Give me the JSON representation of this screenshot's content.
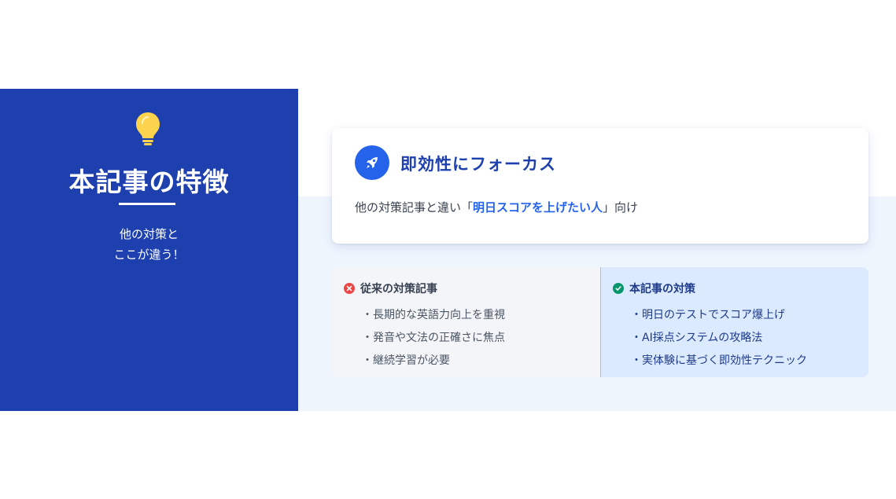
{
  "sidebar": {
    "icon": "lightbulb-icon",
    "title": "本記事の特徴",
    "subtitle_line1": "他の対策と",
    "subtitle_line2": "ここが違う！"
  },
  "card": {
    "icon": "rocket-icon",
    "heading": "即効性にフォーカス",
    "desc_before": "他の対策記事と違い「",
    "desc_highlight": "明日スコアを上げたい人",
    "desc_after": "」向け"
  },
  "comparison": {
    "old": {
      "icon": "x-circle-icon",
      "heading": "従来の対策記事",
      "items": [
        "長期的な英語力向上を重視",
        "発音や文法の正確さに焦点",
        "継続学習が必要"
      ]
    },
    "new": {
      "icon": "check-circle-icon",
      "heading": "本記事の対策",
      "items": [
        "明日のテストでスコア爆上げ",
        "AI採点システムの攻略法",
        "実体験に基づく即効性テクニック"
      ]
    }
  },
  "colors": {
    "brand_blue": "#1e40af",
    "accent_blue": "#2563eb",
    "bulb_yellow": "#fcd34d",
    "x_red": "#ef4444",
    "check_green": "#059669"
  }
}
